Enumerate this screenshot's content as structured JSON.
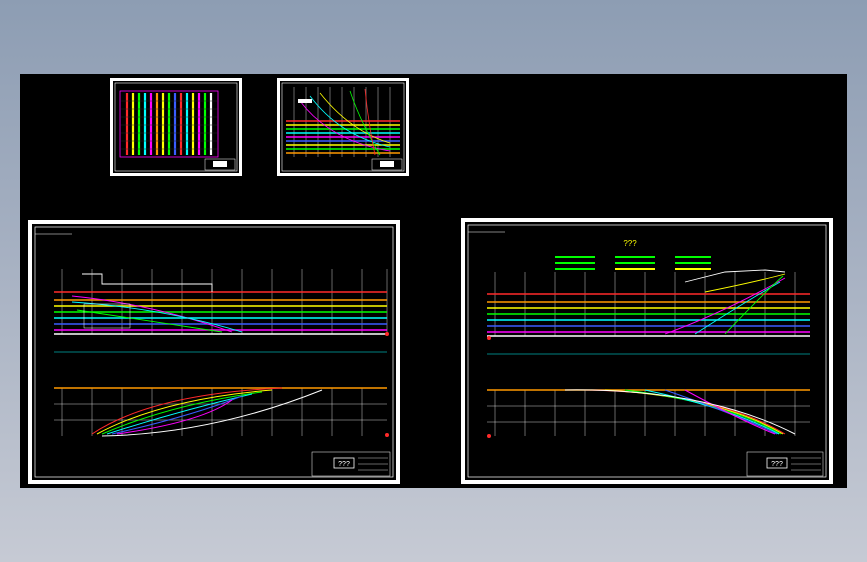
{
  "viewport": {
    "background": "#000000"
  },
  "sheets": [
    {
      "id": "offsets-table",
      "title_block_text": "???"
    },
    {
      "id": "lines-plan-small",
      "title_block_text": "???"
    },
    {
      "id": "body-plan-aft",
      "title_block_text": "???"
    },
    {
      "id": "body-plan-fwd",
      "title_block_text": "???",
      "heading": "???"
    }
  ],
  "colors": {
    "red": "#ff2a2a",
    "yellow": "#ffff00",
    "green": "#00ff00",
    "cyan": "#00ffff",
    "blue": "#3a5cff",
    "magenta": "#ff00ff",
    "white": "#ffffff",
    "orange": "#ff9900"
  }
}
